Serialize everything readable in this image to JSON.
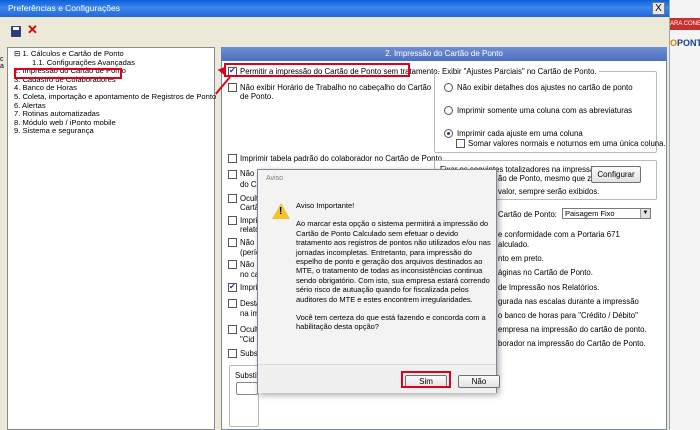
{
  "window": {
    "title": "Preferências e Configurações",
    "close": "X"
  },
  "background_app": {
    "banner": "ARA CONEXÃO",
    "logo_main": "PONT",
    "logo_o": "O"
  },
  "edge_marks": {
    "top": "c",
    "bottom": "a"
  },
  "tree": [
    {
      "label": "⊟ 1. Cálculos e Cartão de Ponto",
      "sub": false
    },
    {
      "label": "1.1. Configurações Avançadas",
      "sub": true
    },
    {
      "label": "2. Impressão do Cartão de Ponto",
      "sub": false
    },
    {
      "label": "3. Cadastro de Colaboradores",
      "sub": false
    },
    {
      "label": "4. Banco de Horas",
      "sub": false
    },
    {
      "label": "5. Coleta, importação e apontamento de Registros de Ponto",
      "sub": false
    },
    {
      "label": "6. Alertas",
      "sub": false
    },
    {
      "label": "7. Rotinas automatizadas",
      "sub": false
    },
    {
      "label": "8. Módulo web / iPonto mobile",
      "sub": false
    },
    {
      "label": "9. Sistema e segurança",
      "sub": false
    }
  ],
  "panel": {
    "header": "2. Impressão do Cartão de Ponto",
    "left": {
      "permitir": "Permitir a impressão do Cartão de Ponto sem tratamento.",
      "nao_exibir_1": "Não exibir Horário de Trabalho no cabeçalho do Cartão",
      "nao_exibir_2": "de Ponto.",
      "imprimir_tabela": "Imprimir tabela padrão do colaborador no Cartão de Ponto.",
      "partial": [
        "Não in",
        "do Ca",
        "Oculta",
        "Cartão",
        "Imprim",
        "relató",
        "Não i",
        "(perío",
        "Não ir",
        "no cab",
        "Imprim",
        "Desta",
        "na im",
        "Oculta",
        "\"Cid",
        "Substi",
        "Substitu"
      ]
    },
    "right": {
      "group_title": "Exibir \"Ajustes Parciais\" no Cartão de Ponto.",
      "radio1": "Não exibir detalhes dos ajustes no cartão de ponto",
      "radio2": "Imprimir somente uma coluna com as abreviaturas",
      "radio3": "Imprimir cada ajuste em uma coluna",
      "somar": "Somar valores normais e noturnos em uma única coluna.",
      "tot1": "Fixar os seguintes totalizadores na impressão",
      "tot2": "ão de Ponto, mesmo que zerados.",
      "configurar": "Configurar",
      "tot3": "valor, sempre serão exibidos.",
      "cartao_label": "Cartão de Ponto:",
      "dropdown": "Paisagem Fixo",
      "partial": [
        "e conformidade com a Portaria 671",
        "alculado.",
        "nto em preto.",
        "áginas no Cartão de Ponto.",
        "de Impressão nos Relatórios.",
        "gurada nas escalas durante a impressão",
        "o banco de horas para \"Crédito / Débito\"",
        "empresa na impressão do cartão de ponto.",
        "borador na impressão do Cartão de Ponto."
      ]
    }
  },
  "dialog": {
    "title": "Aviso",
    "heading": "Aviso Importante!",
    "body": "Ao marcar esta opção o sistema permitirá a impressão do Cartão de Ponto Calculado sem efetuar o devido tratamento aos registros de pontos não utilizados e/ou nas jornadas incompletas. Entretanto, para impressão do espelho de ponto e geração dos arquivos destinados ao MTE, o tratamento de todas as inconsistências continua sendo obrigatório. Com isto, sua empresa estará correndo sério risco de autuação quando for fiscalizada pelos auditores do MTE e estes encontrem irregularidades.",
    "question": "Você tem certeza do que está fazendo e concorda com a habilitação desta opção?",
    "yes": "Sim",
    "no": "Não"
  }
}
